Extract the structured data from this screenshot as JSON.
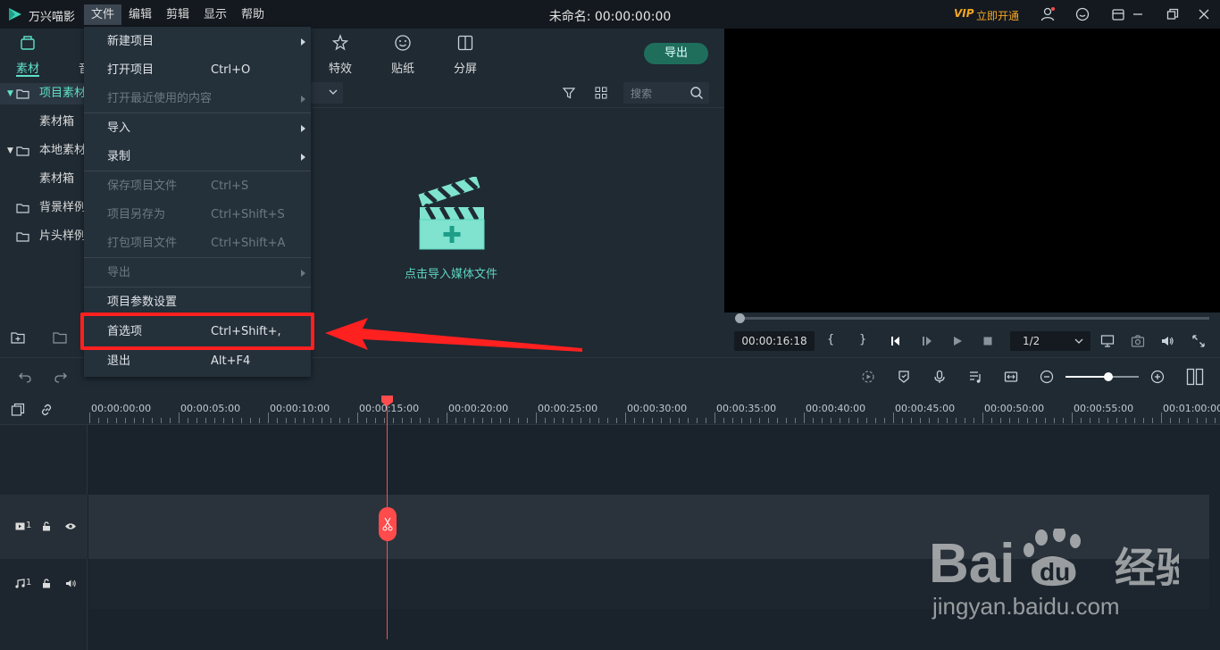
{
  "app": {
    "name": "万兴喵影",
    "doc_title": "未命名: 00:00:00:00",
    "vip_badge": "VIP",
    "vip_label": "立即开通"
  },
  "menubar": [
    {
      "label": "文件",
      "active": true
    },
    {
      "label": "编辑"
    },
    {
      "label": "剪辑"
    },
    {
      "label": "显示"
    },
    {
      "label": "帮助"
    }
  ],
  "left_tabs": [
    {
      "label": "素材",
      "icon": "media-icon"
    },
    {
      "label": "音",
      "icon": "audio-icon"
    }
  ],
  "tree": [
    {
      "label": "项目素材",
      "expanded": true,
      "selected": true
    },
    {
      "label": "素材箱"
    },
    {
      "label": "本地素材",
      "expanded": true
    },
    {
      "label": "素材箱"
    },
    {
      "label": "背景样例"
    },
    {
      "label": "片头样例"
    }
  ],
  "media_tabs": [
    {
      "label": "特效",
      "icon": "effects-icon"
    },
    {
      "label": "贴纸",
      "icon": "sticker-icon"
    },
    {
      "label": "分屏",
      "icon": "split-screen-icon"
    }
  ],
  "export_label": "导出",
  "search_placeholder": "搜索",
  "import_hint": "点击导入媒体文件",
  "preview": {
    "time": "00:00:16:18",
    "ratio": "1/2"
  },
  "ruler_ticks": [
    "00:00:00:00",
    "00:00:05:00",
    "00:00:10:00",
    "00:00:15:00",
    "00:00:20:00",
    "00:00:25:00",
    "00:00:30:00",
    "00:00:35:00",
    "00:00:40:00",
    "00:00:45:00",
    "00:00:50:00",
    "00:00:55:00",
    "00:01:00:00"
  ],
  "tracks": {
    "video_label": "1",
    "audio_label": "1"
  },
  "file_menu": [
    {
      "label": "新建项目",
      "shortcut": "",
      "submenu": true,
      "disabled": false
    },
    {
      "label": "打开项目",
      "shortcut": "Ctrl+O",
      "submenu": false,
      "disabled": false
    },
    {
      "label": "打开最近使用的内容",
      "shortcut": "",
      "submenu": true,
      "disabled": true
    },
    {
      "label": "导入",
      "shortcut": "",
      "submenu": true,
      "disabled": false
    },
    {
      "label": "录制",
      "shortcut": "",
      "submenu": true,
      "disabled": false
    },
    {
      "label": "保存项目文件",
      "shortcut": "Ctrl+S",
      "submenu": false,
      "disabled": true
    },
    {
      "label": "项目另存为",
      "shortcut": "Ctrl+Shift+S",
      "submenu": false,
      "disabled": true
    },
    {
      "label": "打包项目文件",
      "shortcut": "Ctrl+Shift+A",
      "submenu": false,
      "disabled": true
    },
    {
      "label": "导出",
      "shortcut": "",
      "submenu": true,
      "disabled": true
    },
    {
      "label": "项目参数设置",
      "shortcut": "",
      "submenu": false,
      "disabled": false
    },
    {
      "label": "首选项",
      "shortcut": "Ctrl+Shift+,",
      "submenu": false,
      "disabled": false,
      "highlighted": true
    },
    {
      "label": "退出",
      "shortcut": "Alt+F4",
      "submenu": false,
      "disabled": false
    }
  ],
  "watermark": {
    "url": "jingyan.baidu.com"
  },
  "colors": {
    "accent": "#5fe0c8",
    "playhead": "#ff4b4b",
    "highlight": "#ff2020",
    "vip": "#f5a623"
  }
}
